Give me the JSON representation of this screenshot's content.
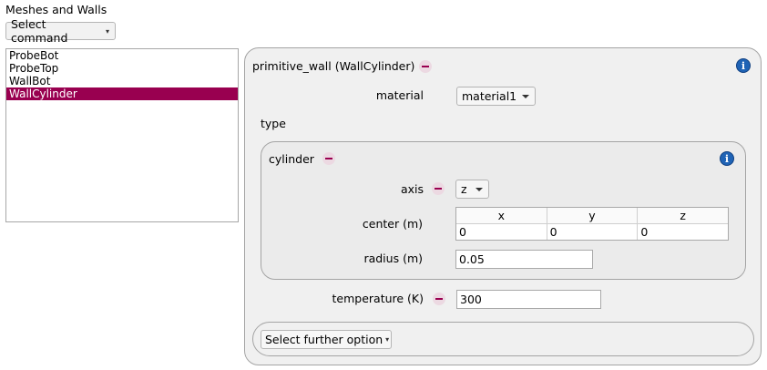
{
  "section": {
    "title": "Meshes and Walls"
  },
  "command": {
    "label": "Select command",
    "arrow": "▾"
  },
  "list": {
    "items": [
      {
        "label": "ProbeBot",
        "selected": false
      },
      {
        "label": "ProbeTop",
        "selected": false
      },
      {
        "label": "WallBot",
        "selected": false
      },
      {
        "label": "WallCylinder",
        "selected": true
      }
    ]
  },
  "panel": {
    "title": "primitive_wall (WallCylinder)",
    "material_label": "material",
    "material_value": "material1",
    "type_label": "type",
    "cylinder": {
      "title": "cylinder",
      "axis_label": "axis",
      "axis_value": "z",
      "center_label": "center (m)",
      "center_headers": [
        "x",
        "y",
        "z"
      ],
      "center_values": [
        "0",
        "0",
        "0"
      ],
      "radius_label": "radius (m)",
      "radius_value": "0.05"
    },
    "temperature_label": "temperature (K)",
    "temperature_value": "300",
    "further_option_label": "Select further option",
    "further_arrow": "▾"
  },
  "icons": {
    "info": "i"
  },
  "colors": {
    "accent": "#990050",
    "info": "#1f63b5"
  }
}
